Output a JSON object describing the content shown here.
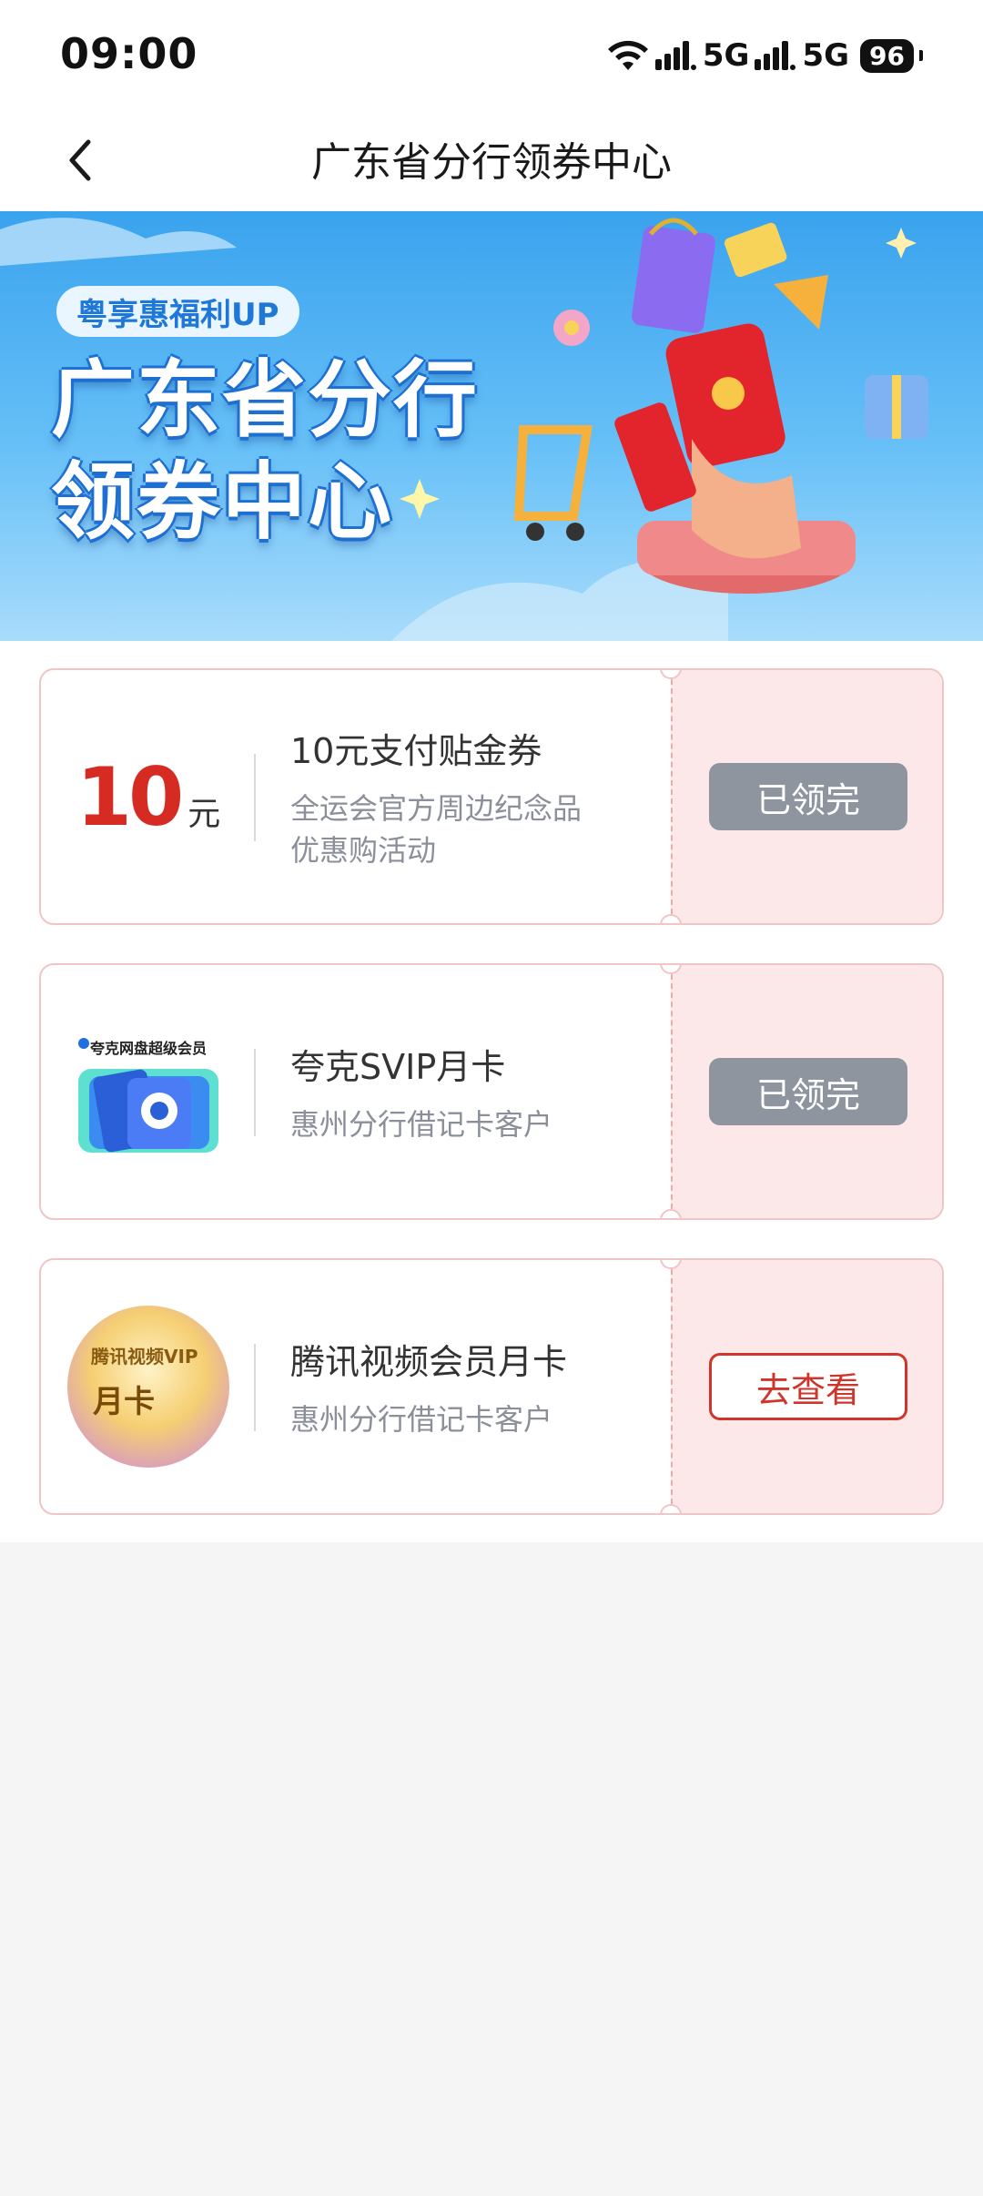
{
  "status_bar": {
    "time": "09:00",
    "network_1": "5G",
    "network_2": "5G",
    "battery": "96"
  },
  "nav": {
    "title": "广东省分行领券中心"
  },
  "banner": {
    "badge": "粤享惠福利UP",
    "title_line1": "广东省分行",
    "title_line2": "领券中心"
  },
  "coupons": [
    {
      "amount": "10",
      "unit": "元",
      "title": "10元支付贴金券",
      "desc_line1": "全运会官方周边纪念品",
      "desc_line2": "优惠购活动",
      "button": "已领完",
      "state": "claimed"
    },
    {
      "logo_caption": "夸克网盘超级会员",
      "title": "夸克SVIP月卡",
      "desc_line1": "惠州分行借记卡客户",
      "button": "已领完",
      "state": "claimed"
    },
    {
      "logo_caption": "腾讯视频VIP",
      "logo_text": "月卡",
      "title": "腾讯视频会员月卡",
      "desc_line1": "惠州分行借记卡客户",
      "button": "去查看",
      "state": "available"
    }
  ],
  "colors": {
    "accent_red": "#d1342a",
    "coupon_right_bg": "#fce8e8",
    "disabled_button": "#8e959f",
    "banner_blue": "#3aa3ee"
  }
}
